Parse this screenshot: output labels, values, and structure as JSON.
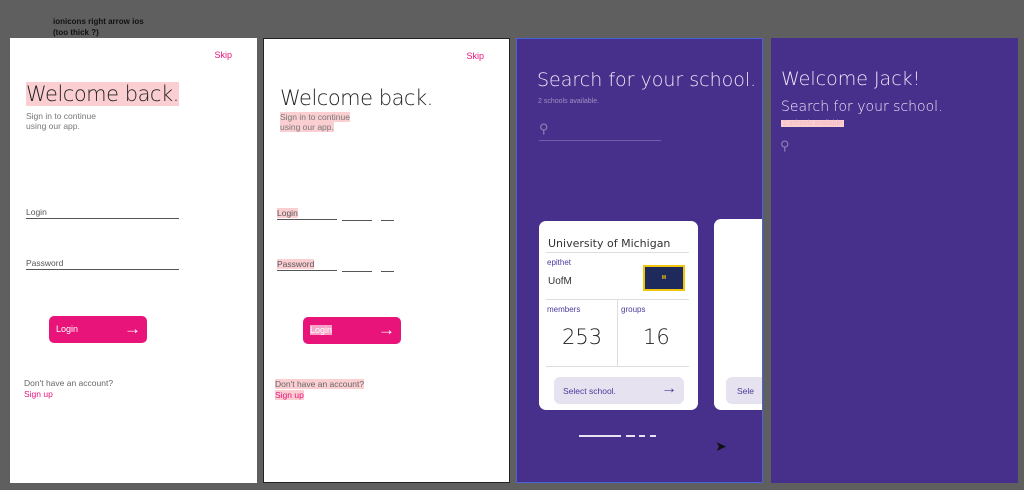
{
  "note": "ionicons right arrow ios\n(too thick ?)",
  "login": {
    "skip": "Skip",
    "title": "Welcome back.",
    "subtitle": "Sign in to continue using our app.",
    "login_label": "Login",
    "password_label": "Password",
    "button": "Login",
    "no_account": "Don't have an account?",
    "signup": "Sign up"
  },
  "search": {
    "title": "Search for your school.",
    "available": "2 schools available.",
    "card": {
      "name": "University of Michigan",
      "epithet_label": "epithet",
      "epithet": "UofM",
      "members_label": "members",
      "members": "253",
      "groups_label": "groups",
      "groups": "16",
      "select": "Select school.",
      "logo_text": "MICHIGAN"
    },
    "card2_select": "Sele"
  },
  "welcome": {
    "title": "Welcome Jack!",
    "subtitle": "Search for your school.",
    "available": "2 schools available"
  },
  "colors": {
    "accent": "#e8147a",
    "purple": "#46308c"
  }
}
